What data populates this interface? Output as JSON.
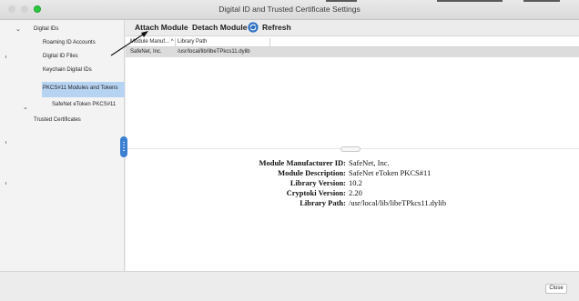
{
  "window": {
    "title": "Digital ID and Trusted Certificate Settings",
    "accent_color": "#b7d3f2",
    "zoom_button_color": "#2bc840"
  },
  "sidebar": {
    "items": [
      {
        "label": "Digital IDs",
        "expanded": true
      },
      {
        "label": "Roaming ID Accounts"
      },
      {
        "label": "Digital ID Files"
      },
      {
        "label": "Keychain Digital IDs"
      },
      {
        "label": "PKCS#11 Modules and Tokens",
        "expanded": true,
        "selected": true
      },
      {
        "label": "SafeNet eToken PKCS#11"
      },
      {
        "label": "Trusted Certificates"
      }
    ]
  },
  "toolbar": {
    "attach_label": "Attach Module",
    "detach_label": "Detach Module",
    "refresh_label": "Refresh",
    "refresh_icon": "refresh-icon"
  },
  "table": {
    "columns": [
      "Module Manuf... ^",
      "Library Path"
    ],
    "rows": [
      [
        "SafeNet, Inc.",
        "/usr/local/lib/libeTPkcs11.dylib"
      ]
    ]
  },
  "details": [
    {
      "label": "Module Manufacturer ID:",
      "value": "SafeNet, Inc."
    },
    {
      "label": "Module Description:",
      "value": "SafeNet eToken PKCS#11"
    },
    {
      "label": "Library Version:",
      "value": "10.2"
    },
    {
      "label": "Cryptoki Version:",
      "value": "2.20"
    },
    {
      "label": "Library Path:",
      "value": "/usr/local/lib/libeTPkcs11.dylib"
    }
  ],
  "footer": {
    "close_label": "Close"
  }
}
